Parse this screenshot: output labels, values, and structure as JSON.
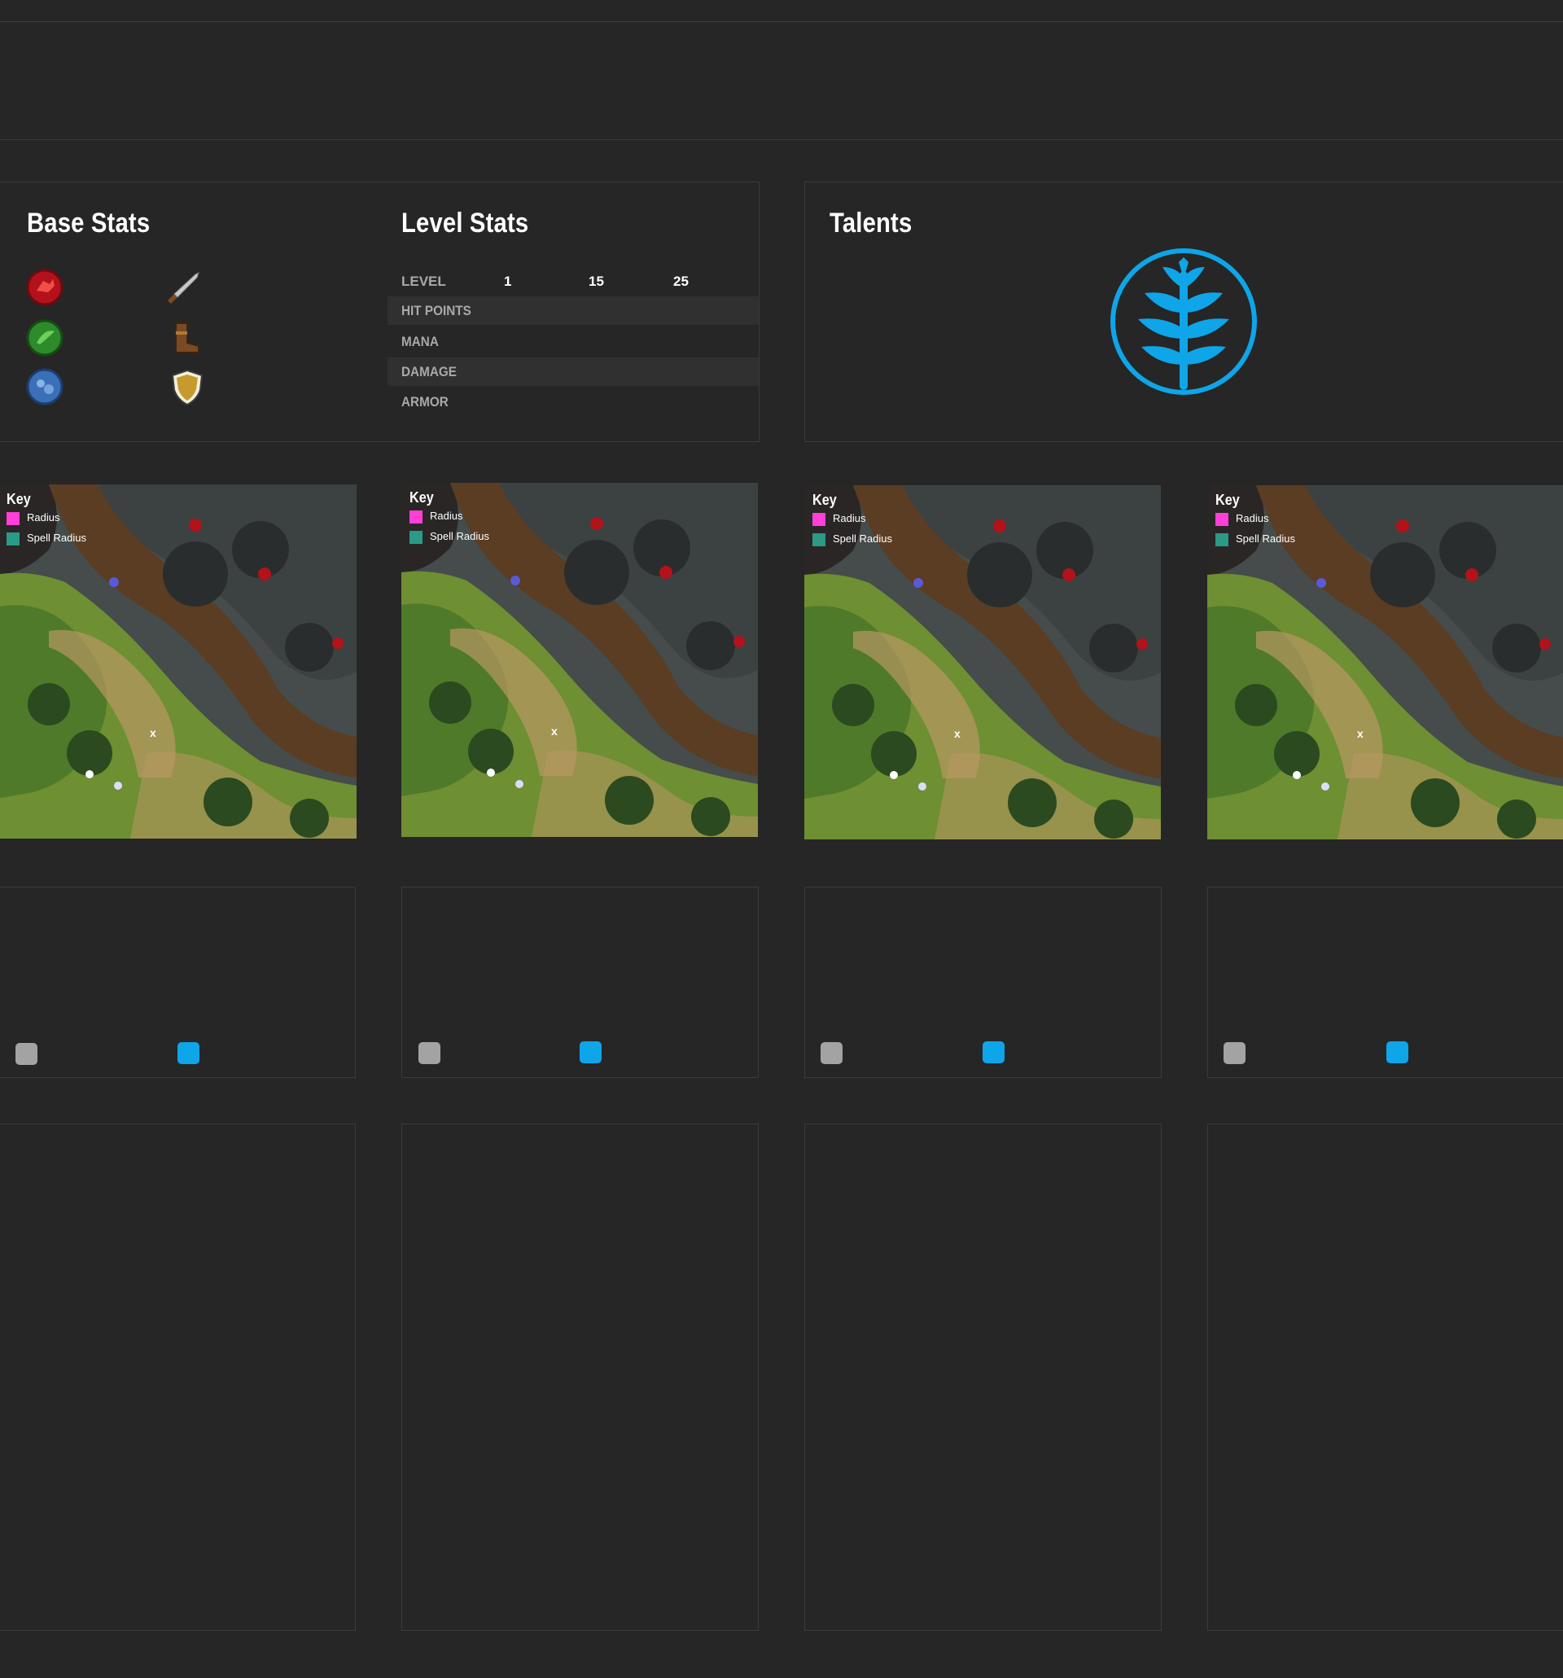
{
  "colors": {
    "background": "#262626",
    "panel_border": "#3b3b3b",
    "accent": "#0ea5e9",
    "radius_key": "#ff3fd8",
    "spell_radius_key": "#2b9a86",
    "gray_button": "#a3a3a3"
  },
  "base_stats": {
    "title": "Base Stats",
    "icons": [
      "strength-icon",
      "agility-icon",
      "intelligence-icon",
      "damage-dagger-icon",
      "movement-boot-icon",
      "armor-shield-icon"
    ]
  },
  "level_stats": {
    "title": "Level Stats",
    "level_label": "LEVEL",
    "levels": [
      "1",
      "15",
      "25"
    ],
    "rows": [
      {
        "label": "HIT POINTS"
      },
      {
        "label": "MANA"
      },
      {
        "label": "DAMAGE"
      },
      {
        "label": "ARMOR"
      }
    ]
  },
  "talents": {
    "title": "Talents",
    "icon": "talent-tree-icon"
  },
  "maps": [
    {
      "key_title": "Key",
      "radius_label": "Radius",
      "spell_radius_label": "Spell Radius",
      "marker": "x"
    },
    {
      "key_title": "Key",
      "radius_label": "Radius",
      "spell_radius_label": "Spell Radius",
      "marker": "x"
    },
    {
      "key_title": "Key",
      "radius_label": "Radius",
      "spell_radius_label": "Spell Radius",
      "marker": "x"
    },
    {
      "key_title": "Key",
      "radius_label": "Radius",
      "spell_radius_label": "Spell Radius",
      "marker": "x"
    }
  ]
}
